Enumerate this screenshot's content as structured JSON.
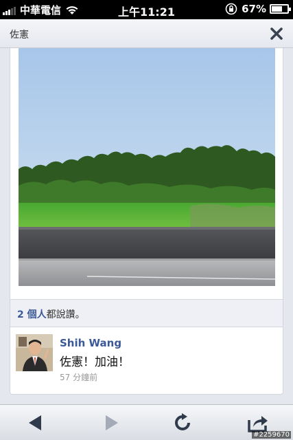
{
  "status_bar": {
    "carrier": "中華電信",
    "time": "上午11:21",
    "battery_percent": "67%",
    "battery_level": 0.67
  },
  "header": {
    "title": "佐憲",
    "close_icon": "close-icon"
  },
  "post": {
    "photo_description_icon": "landscape-photo",
    "likes_count": "2 個人",
    "likes_suffix": "都說讚。"
  },
  "comment": {
    "author": "Shih Wang",
    "text": "佐憲！加油！",
    "timestamp": "57 分鐘前"
  },
  "toolbar": {
    "back_icon": "back-arrow-icon",
    "forward_icon": "forward-arrow-icon",
    "refresh_icon": "refresh-icon",
    "share_icon": "share-icon"
  },
  "watermark": "#2259670",
  "colors": {
    "link_blue": "#3b5998",
    "background": "#e4e7ee"
  }
}
